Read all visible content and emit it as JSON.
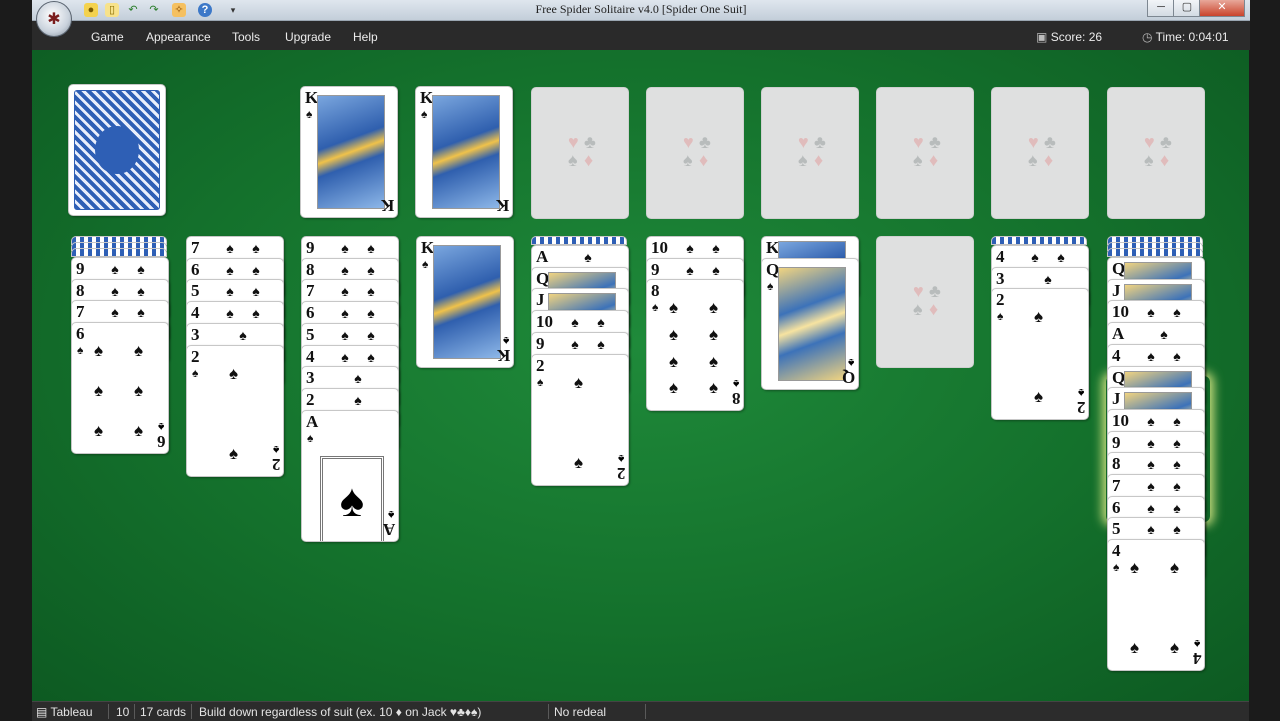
{
  "window": {
    "title": "Free Spider Solitaire v4.0  [Spider One Suit]",
    "minimize_icon": "minimize-icon",
    "maximize_icon": "maximize-icon",
    "close_icon": "close-icon"
  },
  "quick_access": [
    "new-game-icon",
    "notes-icon",
    "undo-icon",
    "redo-icon",
    "hint-icon",
    "help-icon",
    "customize-icon"
  ],
  "menu": {
    "items": [
      "Game",
      "Appearance",
      "Tools",
      "Upgrade",
      "Help"
    ]
  },
  "stats": {
    "score": "Score:  26",
    "time": "Time:  0:04:01"
  },
  "board": {
    "stock": {
      "label": "stock-card-back"
    },
    "foundations": [
      {
        "rank": "K",
        "suit": "♠"
      },
      {
        "rank": "K",
        "suit": "♠"
      }
    ],
    "empty_foundation_symbols": [
      "♥",
      "♣",
      "♠",
      "♦"
    ],
    "columns": [
      {
        "hidden": 3,
        "cards": [
          "9",
          "8",
          "7",
          "6"
        ]
      },
      {
        "hidden": 0,
        "cards": [
          "7",
          "6",
          "5",
          "4",
          "3",
          "2"
        ]
      },
      {
        "hidden": 0,
        "cards": [
          "9",
          "8",
          "7",
          "6",
          "5",
          "4",
          "3",
          "2",
          "A"
        ]
      },
      {
        "hidden": 0,
        "cards": [
          "K"
        ]
      },
      {
        "hidden": 1,
        "cards": [
          "A",
          "Q",
          "J",
          "10",
          "9",
          "2"
        ]
      },
      {
        "hidden": 0,
        "cards": [
          "10",
          "9",
          "8"
        ]
      },
      {
        "hidden": 0,
        "cards": [
          "K",
          "Q"
        ]
      },
      {
        "hidden": 0,
        "cards": []
      },
      {
        "hidden": 1,
        "cards": [
          "4",
          "3",
          "2"
        ]
      },
      {
        "hidden": 3,
        "cards": [
          "Q",
          "J",
          "10",
          "A",
          "4",
          "Q",
          "J",
          "10",
          "9",
          "8",
          "7",
          "6",
          "5",
          "4"
        ]
      }
    ],
    "suit": "♠",
    "felt_color": "#14712c"
  },
  "status": {
    "tableau": "Tableau",
    "columns": "10",
    "cards": "17 cards",
    "rule": "Build down regardless of suit (ex. 10 ♦ on Jack ♥♣♦♠)",
    "redeal": "No redeal"
  }
}
